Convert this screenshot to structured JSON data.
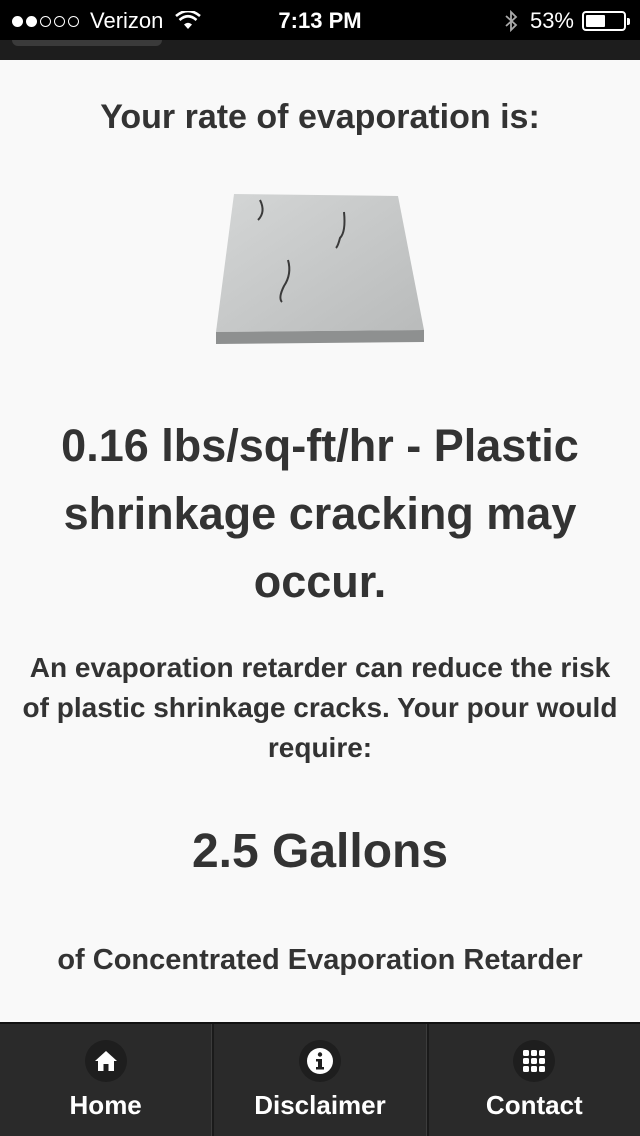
{
  "status_bar": {
    "carrier": "Verizon",
    "time": "7:13 PM",
    "battery_percent": "53%",
    "battery_level": 0.53,
    "signal_bars_full": 2,
    "signal_bars_total": 5
  },
  "main": {
    "heading": "Your rate of evaporation is:",
    "image_icon": "cracked-concrete-slab",
    "result": "0.16 lbs/sq-ft/hr - Plastic shrinkage cracking may occur.",
    "retarder_text": "An evaporation retarder can reduce the risk of plastic shrinkage cracks. Your pour would require:",
    "amount": "2.5 Gallons",
    "product": "of Concentrated Evaporation Retarder"
  },
  "tabbar": {
    "items": [
      {
        "label": "Home",
        "icon": "home-icon"
      },
      {
        "label": "Disclaimer",
        "icon": "info-icon"
      },
      {
        "label": "Contact",
        "icon": "grid-icon"
      }
    ]
  },
  "colors": {
    "background": "#f9f9f9",
    "text": "#333333",
    "tabbar": "#2a2a2a",
    "status_bar": "#000000"
  }
}
